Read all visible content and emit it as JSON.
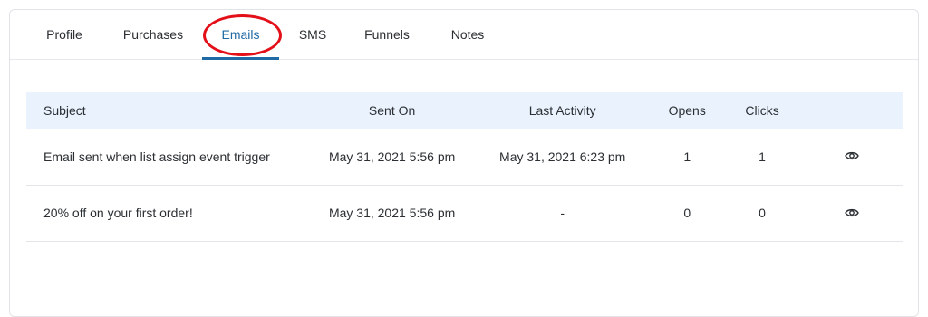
{
  "tabs": [
    {
      "label": "Profile"
    },
    {
      "label": "Purchases"
    },
    {
      "label": "Emails"
    },
    {
      "label": "SMS"
    },
    {
      "label": "Funnels"
    },
    {
      "label": "Notes"
    }
  ],
  "active_tab": "Emails",
  "colors": {
    "accent": "#1f6aa5",
    "highlight_ring": "#e3101a",
    "header_bg": "#eaf3fd"
  },
  "table": {
    "headers": {
      "subject": "Subject",
      "sent_on": "Sent On",
      "last_activity": "Last Activity",
      "opens": "Opens",
      "clicks": "Clicks"
    },
    "rows": [
      {
        "subject": "Email sent when list assign event trigger",
        "sent_on": "May 31, 2021 5:56 pm",
        "last_activity": "May 31, 2021 6:23 pm",
        "opens": "1",
        "clicks": "1",
        "action_icon": "eye-icon"
      },
      {
        "subject": "20% off on your first order!",
        "sent_on": "May 31, 2021 5:56 pm",
        "last_activity": "-",
        "opens": "0",
        "clicks": "0",
        "action_icon": "eye-icon"
      }
    ]
  }
}
